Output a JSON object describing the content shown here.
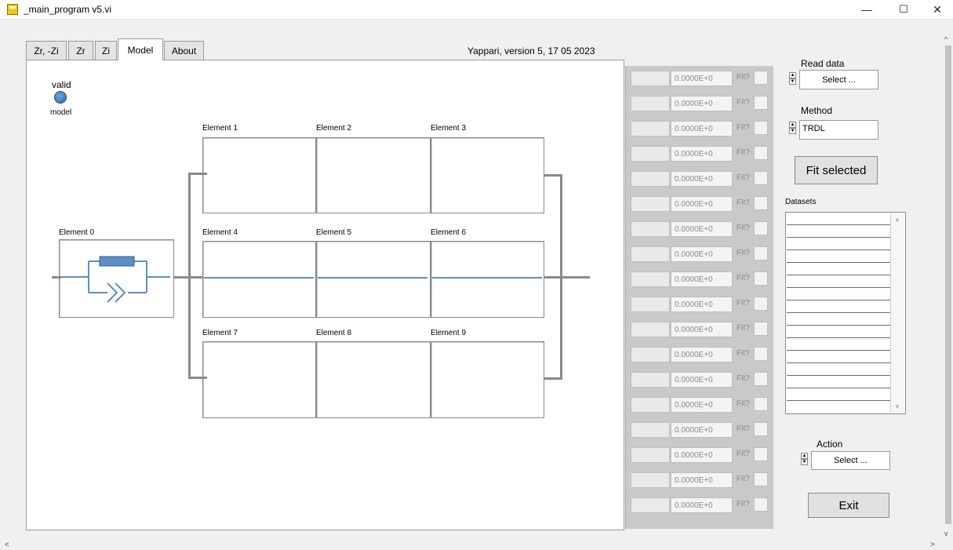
{
  "window": {
    "title": "_main_program v5.vi",
    "min_symbol": "—",
    "max_symbol": "☐",
    "close_symbol": "✕"
  },
  "tabs": [
    {
      "label": "Zr, -Zi"
    },
    {
      "label": "Zr"
    },
    {
      "label": "Zi"
    },
    {
      "label": "Model",
      "active": true
    },
    {
      "label": "About"
    }
  ],
  "version_text": "Yappari, version 5, 17 05 2023",
  "indicator": {
    "top_label": "valid",
    "bottom_label": "model",
    "color": "#3d7fc0"
  },
  "elements": [
    {
      "label": "Element 0"
    },
    {
      "label": "Element 1"
    },
    {
      "label": "Element 2"
    },
    {
      "label": "Element 3"
    },
    {
      "label": "Element 4"
    },
    {
      "label": "Element 5"
    },
    {
      "label": "Element 6"
    },
    {
      "label": "Element 7"
    },
    {
      "label": "Element 8"
    },
    {
      "label": "Element 9"
    }
  ],
  "params": [
    {
      "value": "0.0000E+0",
      "fit": "Fit?"
    },
    {
      "value": "0.0000E+0",
      "fit": "Fit?"
    },
    {
      "value": "0.0000E+0",
      "fit": "Fit?"
    },
    {
      "value": "0.0000E+0",
      "fit": "Fit?"
    },
    {
      "value": "0.0000E+0",
      "fit": "Fit?"
    },
    {
      "value": "0.0000E+0",
      "fit": "Fit?"
    },
    {
      "value": "0.0000E+0",
      "fit": "Fit?"
    },
    {
      "value": "0.0000E+0",
      "fit": "Fit?"
    },
    {
      "value": "0.0000E+0",
      "fit": "Fit?"
    },
    {
      "value": "0.0000E+0",
      "fit": "Fit?"
    },
    {
      "value": "0.0000E+0",
      "fit": "Fit?"
    },
    {
      "value": "0.0000E+0",
      "fit": "Fit?"
    },
    {
      "value": "0.0000E+0",
      "fit": "Fit?"
    },
    {
      "value": "0.0000E+0",
      "fit": "Fit?"
    },
    {
      "value": "0.0000E+0",
      "fit": "Fit?"
    },
    {
      "value": "0.0000E+0",
      "fit": "Fit?"
    },
    {
      "value": "0.0000E+0",
      "fit": "Fit?"
    },
    {
      "value": "0.0000E+0",
      "fit": "Fit?"
    }
  ],
  "read_data": {
    "label": "Read data",
    "value": "Select ..."
  },
  "method": {
    "label": "Method",
    "value": "TRDL"
  },
  "fit_selected_label": "Fit selected",
  "datasets": {
    "label": "Datasets",
    "rows": 15
  },
  "action": {
    "label": "Action",
    "value": "Select ..."
  },
  "exit_label": "Exit",
  "colors": {
    "circuit_blue": "#5b8fc4",
    "led_blue": "#3d7fc0",
    "param_bg": "#c9c9c9"
  }
}
